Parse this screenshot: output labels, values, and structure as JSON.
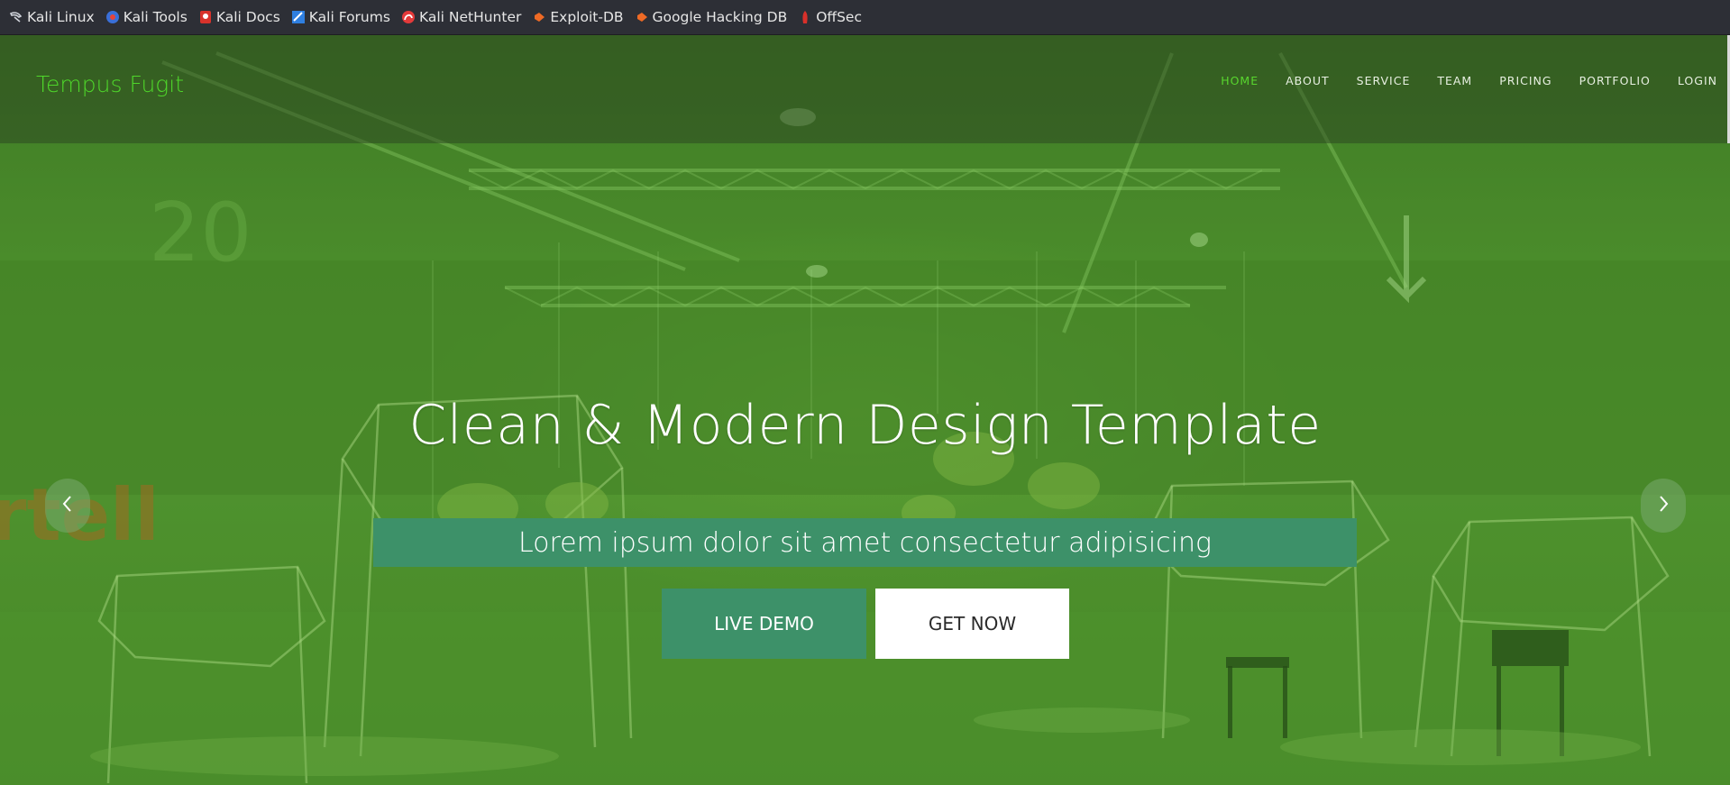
{
  "bookmarks": [
    {
      "label": "Kali Linux",
      "icon": "kali-dragon-icon"
    },
    {
      "label": "Kali Tools",
      "icon": "kali-tools-icon"
    },
    {
      "label": "Kali Docs",
      "icon": "kali-docs-icon"
    },
    {
      "label": "Kali Forums",
      "icon": "kali-forums-icon"
    },
    {
      "label": "Kali NetHunter",
      "icon": "nethunter-icon"
    },
    {
      "label": "Exploit-DB",
      "icon": "exploit-db-icon"
    },
    {
      "label": "Google Hacking DB",
      "icon": "ghdb-icon"
    },
    {
      "label": "OffSec",
      "icon": "offsec-icon"
    }
  ],
  "navbar": {
    "brand": "Tempus Fugit",
    "menu": [
      "HOME",
      "ABOUT",
      "SERVICE",
      "TEAM",
      "PRICING",
      "PORTFOLIO",
      "LOGIN"
    ],
    "active": "HOME"
  },
  "hero": {
    "headline": "Clean & Modern Design Template",
    "subline": "Lorem ipsum dolor sit amet consectetur adipisicing",
    "primary_button": "LIVE DEMO",
    "secondary_button": "GET NOW",
    "prev_icon": "chevron-left-icon",
    "next_icon": "chevron-right-icon"
  },
  "colors": {
    "brand": "#4ed62a",
    "accent": "#3d9169",
    "bookmark_bar": "#2d2f36"
  }
}
